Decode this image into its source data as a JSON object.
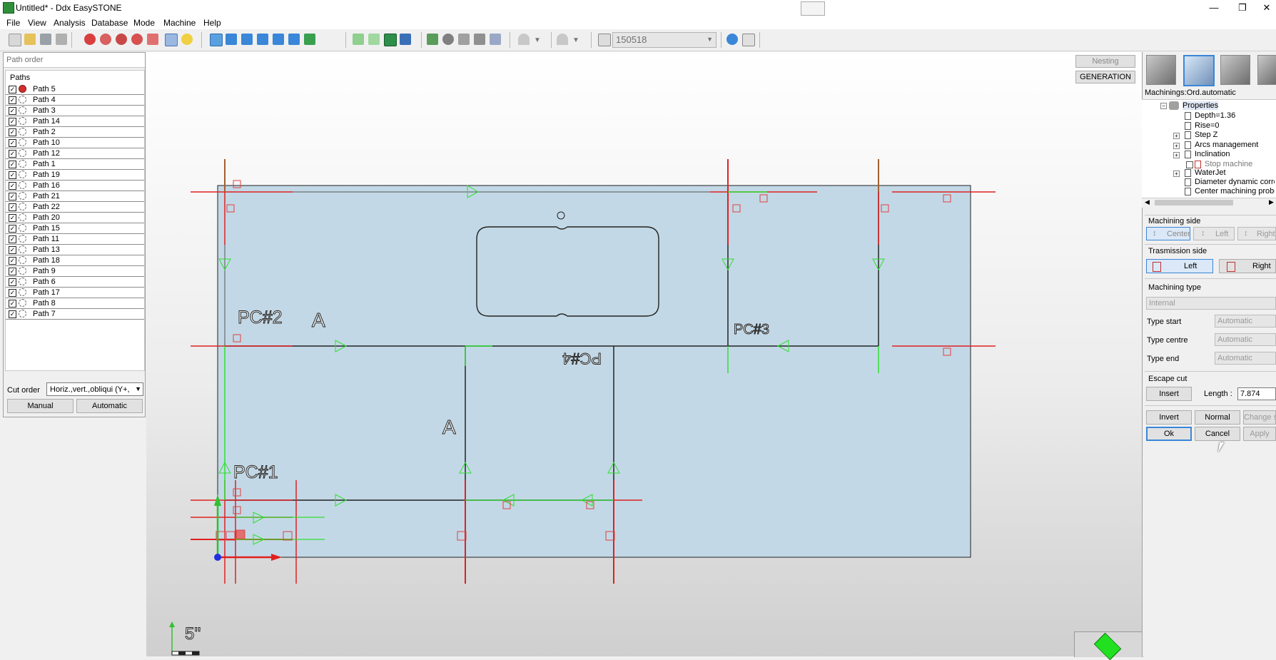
{
  "window": {
    "title": "Untitled* - Ddx EasySTONE",
    "minimize": "—",
    "maximize": "❐",
    "close": "✕"
  },
  "menu": [
    "File",
    "View",
    "Analysis",
    "Database",
    "Mode",
    "Machine",
    "Help"
  ],
  "toolbar": {
    "combo_value": "150518"
  },
  "left_panel": {
    "header": "Path order",
    "list_title": "Paths",
    "paths": [
      "Path 5",
      "Path 4",
      "Path 3",
      "Path 14",
      "Path 2",
      "Path 10",
      "Path 12",
      "Path 1",
      "Path 19",
      "Path 16",
      "Path 21",
      "Path 22",
      "Path 20",
      "Path 15",
      "Path 11",
      "Path 13",
      "Path 18",
      "Path 9",
      "Path 6",
      "Path 17",
      "Path 8",
      "Path 7"
    ],
    "cut_order_label": "Cut order",
    "cut_order_value": "Horiz.,vert.,obliqui (Y+,",
    "manual_button": "Manual",
    "automatic_button": "Automatic"
  },
  "canvas": {
    "labels": {
      "pc2": "PC#2",
      "a1": "A",
      "pc3": "PC#3",
      "pc4": "PC#4",
      "a2": "A",
      "pc1": "PC#1"
    },
    "scale_text": "5''"
  },
  "canvas_buttons": {
    "nesting": "Nesting",
    "generation": "GENERATION"
  },
  "right_panel": {
    "machinings_title": "Machinings:Ord.automatic",
    "tree": {
      "root": "Properties",
      "items": [
        "Depth=1.36",
        "Rise=0",
        "Step Z",
        "Arcs management",
        "Inclination",
        "Stop machine",
        "WaterJet",
        "Diameter dynamic correction",
        "Center machining probe"
      ]
    },
    "machining_side": {
      "title": "Machining side",
      "center": "Center",
      "left": "Left",
      "right": "Right"
    },
    "transmission_side": {
      "title": "Trasmission side",
      "left": "Left",
      "right": "Right"
    },
    "machining_type": {
      "title": "Machining type",
      "value": "Internal",
      "type_start_label": "Type start",
      "type_start_value": "Automatic",
      "type_centre_label": "Type centre",
      "type_centre_value": "Automatic",
      "type_end_label": "Type end",
      "type_end_value": "Automatic"
    },
    "escape_cut": {
      "title": "Escape cut",
      "insert_button": "Insert",
      "length_label": "Length :",
      "length_value": "7.874"
    },
    "invert_button": "Invert",
    "normal_button": "Normal",
    "change_start_button": "Change st",
    "ok_button": "Ok",
    "cancel_button": "Cancel",
    "apply_button": "Apply"
  }
}
